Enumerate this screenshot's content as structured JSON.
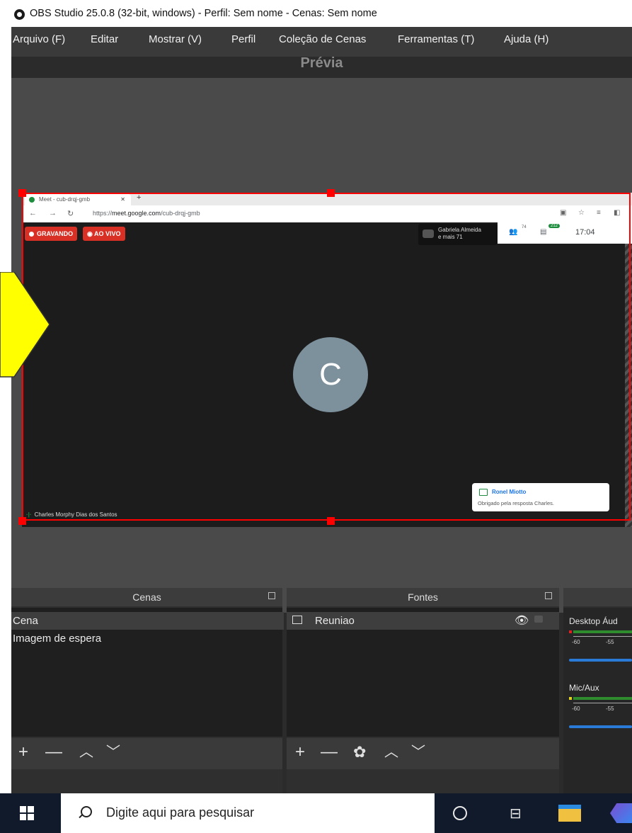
{
  "window": {
    "title": "OBS Studio 25.0.8 (32-bit, windows) - Perfil: Sem nome - Cenas: Sem nome"
  },
  "menu": [
    "Arquivo (F)",
    "Editar",
    "Mostrar (V)",
    "Perfil",
    "Coleção de Cenas",
    "Ferramentas (T)",
    "Ajuda (H)"
  ],
  "preview": {
    "label": "Prévia"
  },
  "meet": {
    "tab_title": "Meet - cub-drqj-gmb",
    "url_prefix": "https://",
    "url_domain": "meet.google.com",
    "url_path": "/cub-drqj-gmb",
    "recording": "GRAVANDO",
    "live": "AO VIVO",
    "presenter_line1": "Gabriela Almeida",
    "presenter_line2": "e mais 71",
    "participants_count": "74",
    "chat_badge": "212",
    "time": "17:04",
    "avatar_letter": "C",
    "chat_name": "Ronel Miotto",
    "chat_message": "Obrigado pela resposta Charles.",
    "speaker": "Charles Morphy Dias dos Santos"
  },
  "docks": {
    "scenes": {
      "title": "Cenas",
      "items": [
        "Cena",
        "Imagem de espera"
      ],
      "selected": 0
    },
    "sources": {
      "title": "Fontes",
      "items": [
        "Reuniao"
      ]
    },
    "mixer": {
      "channels": [
        {
          "name": "Desktop Áud",
          "ticks": [
            "-60",
            "-55"
          ]
        },
        {
          "name": "Mic/Aux",
          "ticks": [
            "-60",
            "-55"
          ]
        }
      ]
    }
  },
  "taskbar": {
    "search_placeholder": "Digite aqui para pesquisar"
  },
  "colors": {
    "selection": "#ff0000",
    "annotation_arrow": "#ffff00",
    "meet_avatar": "#7d919d",
    "recording": "#d93025"
  }
}
